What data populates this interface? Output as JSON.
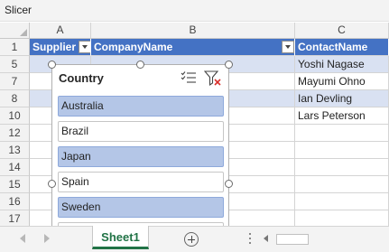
{
  "window": {
    "title": "Slicer"
  },
  "grid": {
    "columns": [
      "A",
      "B",
      "C"
    ],
    "header_row": {
      "row_number": "1",
      "cells": [
        "Supplier",
        "CompanyName",
        "ContactName"
      ]
    },
    "rows": [
      {
        "row_number": "5",
        "c": "Yoshi Nagase"
      },
      {
        "row_number": "7",
        "c": "Mayumi Ohno"
      },
      {
        "row_number": "8",
        "c": "Ian Devling"
      },
      {
        "row_number": "10",
        "c": "Lars Peterson"
      },
      {
        "row_number": "12",
        "c": ""
      },
      {
        "row_number": "13",
        "c": ""
      },
      {
        "row_number": "14",
        "c": ""
      },
      {
        "row_number": "15",
        "c": ""
      },
      {
        "row_number": "16",
        "c": ""
      },
      {
        "row_number": "17",
        "c": ""
      },
      {
        "row_number": "",
        "c": ""
      }
    ]
  },
  "slicer": {
    "title": "Country",
    "items": [
      {
        "label": "Australia",
        "selected": true
      },
      {
        "label": "Brazil",
        "selected": false
      },
      {
        "label": "Japan",
        "selected": true
      },
      {
        "label": "Spain",
        "selected": false
      },
      {
        "label": "Sweden",
        "selected": true
      }
    ],
    "icons": [
      "multi-select-icon",
      "clear-filter-icon"
    ]
  },
  "sheet_tabs": {
    "active": "Sheet1"
  },
  "colors": {
    "table_header": "#4472c4",
    "band_row": "#d9e1f2",
    "slicer_selected": "#b4c6e7",
    "sheet_tab_accent": "#217346",
    "clear_filter_x": "#d9302c"
  }
}
